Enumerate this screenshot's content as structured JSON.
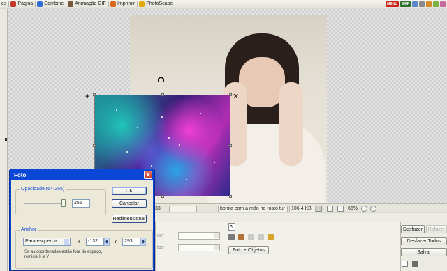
{
  "toolbar": {
    "items": [
      {
        "label": "Página",
        "icon": "page-icon",
        "color": "#c0392b"
      },
      {
        "label": "Combine",
        "icon": "combine-icon",
        "color": "#2e6fd6"
      },
      {
        "label": "Animação GIF",
        "icon": "gif-icon",
        "color": "#7a5a3c"
      },
      {
        "label": "Imprimir",
        "icon": "print-icon",
        "color": "#d9691e"
      },
      {
        "label": "PhotoScape",
        "icon": "photoscape-icon",
        "color": "#e0a800"
      }
    ],
    "badges": [
      "MENU",
      "EXIF"
    ]
  },
  "statusbar": {
    "index": "33",
    "filename": "bonita com a mão no rosto tur",
    "filesize": "106.4 KB",
    "zoom": "65%"
  },
  "bottom_panel": {
    "label_a": "ner",
    "label_b": "ton",
    "photo_objects_button": "Foto + Objetos",
    "undo_button": "Desfazer",
    "redo_button": "Refazer",
    "undo_all_button": "Desfazer Todos",
    "save_button": "Salvar"
  },
  "dialog": {
    "title": "Foto",
    "opacity_group_label": "Opacidade (64-255)",
    "opacity_value": "255",
    "opacity_fraction": 1.0,
    "ok_button": "OK",
    "cancel_button": "Cancelar",
    "resize_button": "Redimensionar",
    "anchor_group_label": "Anchor",
    "anchor_option": "Para esquerda",
    "x_label": "x",
    "x_value": "-132",
    "y_label": "Y",
    "y_value": "293",
    "note": "Se as coordenadas estão fora do espaço, reinicie X e Y"
  }
}
